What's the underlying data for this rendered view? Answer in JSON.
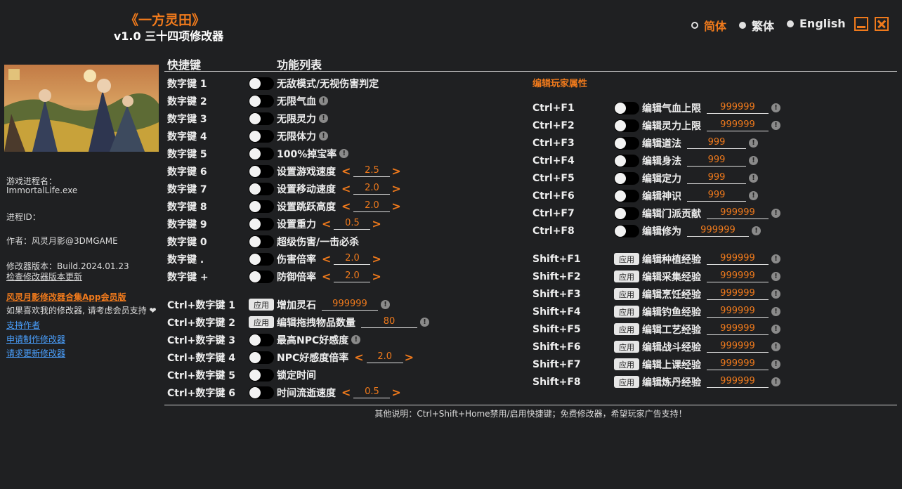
{
  "header": {
    "title": "《一方灵田》",
    "subtitle": "v1.0 三十四项修改器"
  },
  "languages": [
    {
      "label": "简体",
      "active": true
    },
    {
      "label": "繁体",
      "active": false
    },
    {
      "label": "English",
      "active": false
    }
  ],
  "sidebar": {
    "process_label": "游戏进程名：",
    "process_name": "ImmortalLife.exe",
    "pid_label": "进程ID：",
    "author": "作者：风灵月影@3DMGAME",
    "version": "修改器版本：Build.2024.01.23",
    "check_update": "检查修改器版本更新",
    "promo": "风灵月影修改器合集App会员版",
    "support_text": "如果喜欢我的修改器, 请考虑会员支持",
    "heart": "❤",
    "links": [
      "支持作者",
      "申请制作修改器",
      "请求更新修改器"
    ]
  },
  "columns": {
    "hotkey": "快捷键",
    "features": "功能列表"
  },
  "colors": {
    "accent": "#f07a1c",
    "background": "#1f2022",
    "link": "#4aa0ff"
  },
  "apply_label": "应用",
  "left_features": [
    {
      "key": "数字键 1",
      "name": "无敌模式/无视伤害判定",
      "control": "toggle",
      "info": false
    },
    {
      "key": "数字键 2",
      "name": "无限气血",
      "control": "toggle",
      "info": true
    },
    {
      "key": "数字键 3",
      "name": "无限灵力",
      "control": "toggle",
      "info": true
    },
    {
      "key": "数字键 4",
      "name": "无限体力",
      "control": "toggle",
      "info": true
    },
    {
      "key": "数字键 5",
      "name": "100%掉宝率",
      "control": "toggle",
      "info": true
    },
    {
      "key": "数字键 6",
      "name": "设置游戏速度",
      "control": "toggle",
      "stepper": "2.5",
      "info": false
    },
    {
      "key": "数字键 7",
      "name": "设置移动速度",
      "control": "toggle",
      "stepper": "2.0",
      "info": false
    },
    {
      "key": "数字键 8",
      "name": "设置跳跃高度",
      "control": "toggle",
      "stepper": "2.0",
      "info": false
    },
    {
      "key": "数字键 9",
      "name": "设置重力",
      "control": "toggle",
      "stepper": "0.5",
      "info": false
    },
    {
      "key": "数字键 0",
      "name": "超级伤害/一击必杀",
      "control": "toggle",
      "info": false
    },
    {
      "key": "数字键 .",
      "name": "伤害倍率",
      "control": "toggle",
      "stepper": "2.0",
      "info": false
    },
    {
      "key": "数字键 +",
      "name": "防御倍率",
      "control": "toggle",
      "stepper": "2.0",
      "info": false
    },
    {
      "gap": true
    },
    {
      "key": "Ctrl+数字键 1",
      "name": "增加灵石",
      "control": "apply",
      "value": "999999",
      "info": true
    },
    {
      "key": "Ctrl+数字键 2",
      "name": "编辑拖拽物品数量",
      "control": "apply",
      "value": "80",
      "info": true
    },
    {
      "key": "Ctrl+数字键 3",
      "name": "最高NPC好感度",
      "control": "toggle",
      "info": true
    },
    {
      "key": "Ctrl+数字键 4",
      "name": "NPC好感度倍率",
      "control": "toggle",
      "stepper": "2.0",
      "info": false
    },
    {
      "key": "Ctrl+数字键 5",
      "name": "锁定时间",
      "control": "toggle",
      "info": false
    },
    {
      "key": "Ctrl+数字键 6",
      "name": "时间流逝速度",
      "control": "toggle",
      "stepper": "0.5",
      "info": false
    }
  ],
  "right_section_title": "编辑玩家属性",
  "right_features": [
    {
      "key": "Ctrl+F1",
      "name": "编辑气血上限",
      "control": "toggle",
      "value": "999999",
      "info": true
    },
    {
      "key": "Ctrl+F2",
      "name": "编辑灵力上限",
      "control": "toggle",
      "value": "999999",
      "info": true
    },
    {
      "key": "Ctrl+F3",
      "name": "编辑道法",
      "control": "toggle",
      "value": "999",
      "info": true
    },
    {
      "key": "Ctrl+F4",
      "name": "编辑身法",
      "control": "toggle",
      "value": "999",
      "info": true
    },
    {
      "key": "Ctrl+F5",
      "name": "编辑定力",
      "control": "toggle",
      "value": "999",
      "info": true
    },
    {
      "key": "Ctrl+F6",
      "name": "编辑神识",
      "control": "toggle",
      "value": "999",
      "info": true
    },
    {
      "key": "Ctrl+F7",
      "name": "编辑门派贡献",
      "control": "toggle",
      "value": "999999",
      "info": true
    },
    {
      "key": "Ctrl+F8",
      "name": "编辑修为",
      "control": "toggle",
      "value": "999999",
      "info": true
    },
    {
      "gap": true
    },
    {
      "key": "Shift+F1",
      "name": "编辑种植经验",
      "control": "apply",
      "value": "999999",
      "info": true
    },
    {
      "key": "Shift+F2",
      "name": "编辑采集经验",
      "control": "apply",
      "value": "999999",
      "info": true
    },
    {
      "key": "Shift+F3",
      "name": "编辑烹饪经验",
      "control": "apply",
      "value": "999999",
      "info": true
    },
    {
      "key": "Shift+F4",
      "name": "编辑钓鱼经验",
      "control": "apply",
      "value": "999999",
      "info": true
    },
    {
      "key": "Shift+F5",
      "name": "编辑工艺经验",
      "control": "apply",
      "value": "999999",
      "info": true
    },
    {
      "key": "Shift+F6",
      "name": "编辑战斗经验",
      "control": "apply",
      "value": "999999",
      "info": true
    },
    {
      "key": "Shift+F7",
      "name": "编辑上课经验",
      "control": "apply",
      "value": "999999",
      "info": true
    },
    {
      "key": "Shift+F8",
      "name": "编辑炼丹经验",
      "control": "apply",
      "value": "999999",
      "info": true
    }
  ],
  "footer": "其他说明：Ctrl+Shift+Home禁用/启用快捷键；免费修改器，希望玩家广告支持！"
}
